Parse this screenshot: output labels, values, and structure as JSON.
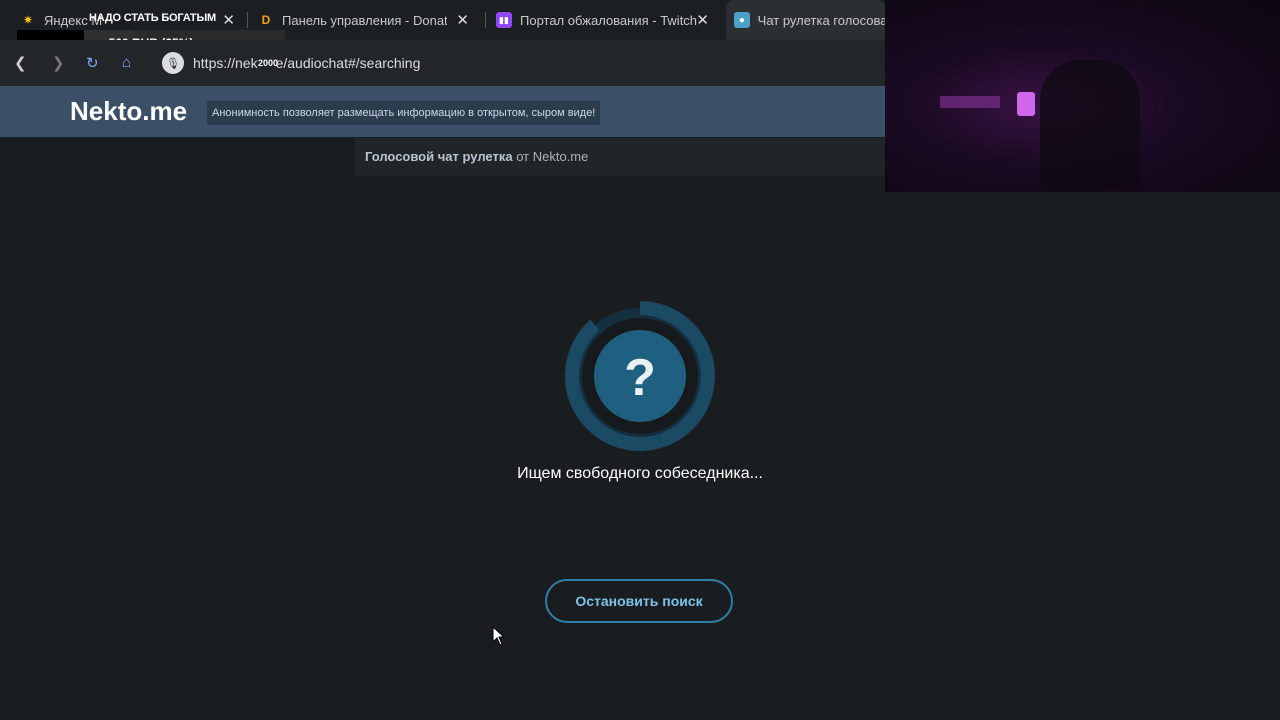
{
  "browser": {
    "tabs": [
      {
        "label": "Яндекс М",
        "icon": "yandex-star-icon"
      },
      {
        "label": "Панель управления - Donatio",
        "icon": "donationalerts-icon"
      },
      {
        "label": "Портал обжалования - Twitch",
        "icon": "twitch-icon"
      },
      {
        "label": "Чат рулетка голосовая",
        "icon": "nekto-mic-icon"
      }
    ],
    "url": "https://nekto.me/audiochat#/searching",
    "url_visible": "https://nek",
    "url_rest": "e/audiochat#/searching",
    "zoom": "2000"
  },
  "overlay": {
    "donation_message": "НАДО СТАТЬ БОГАТЫМ",
    "donation_amount": "500 RUB (25%)",
    "donation_progress": 0.25
  },
  "site": {
    "logo": "Nekto.me",
    "slogan": "Анонимность позволяет размещать информацию в открытом, сыром виде!",
    "subtitle_bold": "Голосовой чат рулетка",
    "subtitle_rest": "от Nekto.me"
  },
  "main": {
    "spinner_symbol": "?",
    "status_text": "Ищем свободного собеседника...",
    "stop_button": "Остановить поиск"
  },
  "colors": {
    "accent": "#2e7fa8",
    "spinner_inner": "#1f5f80",
    "header": "#3b4f66"
  }
}
